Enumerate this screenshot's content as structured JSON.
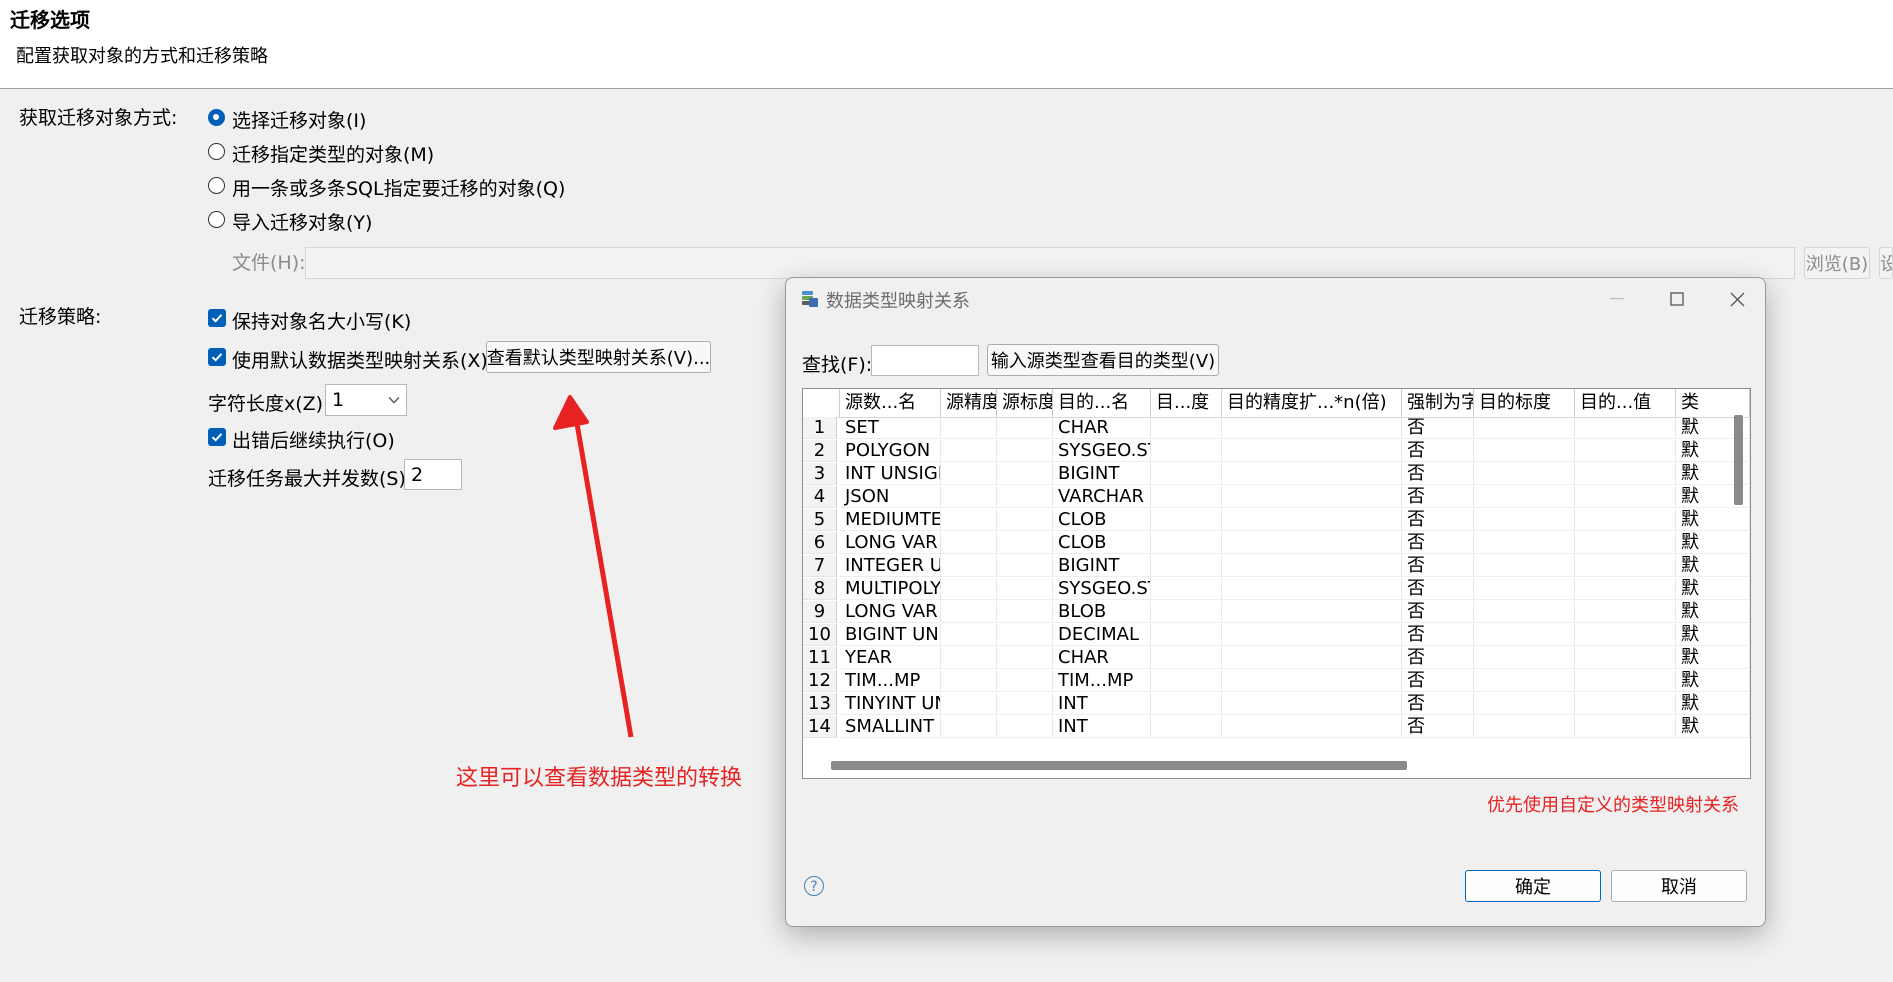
{
  "header": {
    "title": "迁移选项",
    "subtitle": "配置获取对象的方式和迁移策略"
  },
  "acquire": {
    "label": "获取迁移对象方式:",
    "options": [
      "选择迁移对象(I)",
      "迁移指定类型的对象(M)",
      "用一条或多条SQL指定要迁移的对象(Q)",
      "导入迁移对象(Y)"
    ],
    "selected_index": 0,
    "file_label": "文件(H):",
    "file_value": "",
    "browse_label": "浏览(B)",
    "cut_label": "设"
  },
  "strategy": {
    "label": "迁移策略:",
    "keep_case": "保持对象名大小写(K)",
    "keep_case_checked": true,
    "use_default_mapping": "使用默认数据类型映射关系(X)",
    "use_default_mapping_checked": true,
    "view_mapping_button": "查看默认类型映射关系(V)...",
    "char_len_label": "字符长度x(Z):",
    "char_len_value": "1",
    "continue_on_error": "出错后继续执行(O)",
    "continue_on_error_checked": true,
    "max_concurrency_label": "迁移任务最大并发数(S):",
    "max_concurrency_value": "2"
  },
  "annotation": {
    "text": "这里可以查看数据类型的转换",
    "color": "#e62222"
  },
  "dialog": {
    "title": "数据类型映射关系",
    "find_label": "查找(F):",
    "find_value": "",
    "lookup_button": "输入源类型查看目的类型(V)",
    "columns": [
      "源数...名",
      "源精度",
      "源标度",
      "目的...名",
      "目...度",
      "目的精度扩...*n(倍)",
      "强制为字",
      "目的标度",
      "目的...值",
      "类"
    ],
    "rows": [
      {
        "n": "1",
        "src": "SET",
        "dst": "CHAR",
        "force": "否",
        "kind": "默"
      },
      {
        "n": "2",
        "src": "POLYGON",
        "dst": "SYSGEO.ST",
        "force": "否",
        "kind": "默"
      },
      {
        "n": "3",
        "src": "INT UNSIGI",
        "dst": "BIGINT",
        "force": "否",
        "kind": "默"
      },
      {
        "n": "4",
        "src": "JSON",
        "dst": "VARCHAR",
        "force": "否",
        "kind": "默"
      },
      {
        "n": "5",
        "src": "MEDIUMTE",
        "dst": "CLOB",
        "force": "否",
        "kind": "默"
      },
      {
        "n": "6",
        "src": "LONG VAR",
        "dst": "CLOB",
        "force": "否",
        "kind": "默"
      },
      {
        "n": "7",
        "src": "INTEGER U",
        "dst": "BIGINT",
        "force": "否",
        "kind": "默"
      },
      {
        "n": "8",
        "src": "MULTIPOLY",
        "dst": "SYSGEO.ST",
        "force": "否",
        "kind": "默"
      },
      {
        "n": "9",
        "src": "LONG VAR",
        "dst": "BLOB",
        "force": "否",
        "kind": "默"
      },
      {
        "n": "10",
        "src": "BIGINT UNS",
        "dst": "DECIMAL",
        "force": "否",
        "kind": "默"
      },
      {
        "n": "11",
        "src": "YEAR",
        "dst": "CHAR",
        "force": "否",
        "kind": "默"
      },
      {
        "n": "12",
        "src": "TIM...MP",
        "dst": "TIM...MP",
        "force": "否",
        "kind": "默"
      },
      {
        "n": "13",
        "src": "TINYINT UN",
        "dst": "INT",
        "force": "否",
        "kind": "默"
      },
      {
        "n": "14",
        "src": "SMALLINT",
        "dst": "INT",
        "force": "否",
        "kind": "默"
      }
    ],
    "note": "优先使用自定义的类型映射关系",
    "help_symbol": "?",
    "ok": "确定",
    "cancel": "取消",
    "colors": {
      "accent": "#005fb8",
      "note": "#e62222"
    }
  }
}
